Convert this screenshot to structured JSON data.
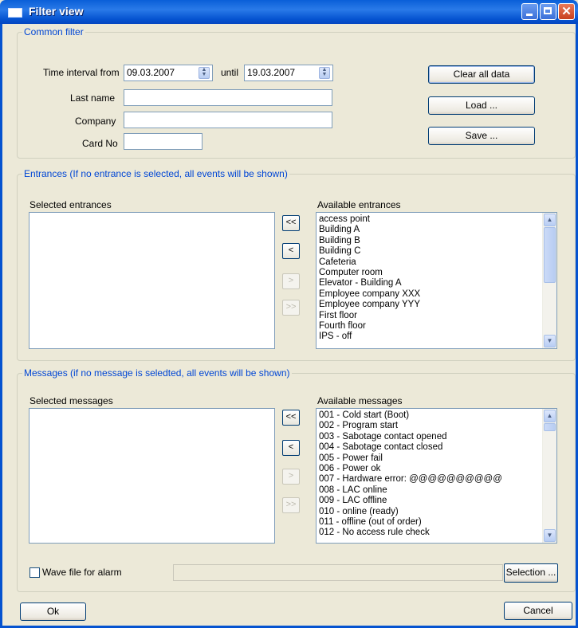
{
  "window": {
    "title": "Filter view"
  },
  "common_filter": {
    "legend": "Common filter",
    "time_from_label": "Time interval from",
    "time_from_value": "09.03.2007",
    "until_label": "until",
    "until_value": "19.03.2007",
    "last_name_label": "Last name",
    "last_name_value": "",
    "company_label": "Company",
    "company_value": "",
    "card_no_label": "Card No",
    "card_no_value": "",
    "clear_label": "Clear all data",
    "load_label": "Load ...",
    "save_label": "Save ..."
  },
  "entrances": {
    "legend": "Entrances (If  no entrance is selected, all events will be shown)",
    "selected_label": "Selected entrances",
    "available_label": "Available entrances",
    "available_items": [
      "access point",
      "Building A",
      "Building B",
      "Building C",
      "Cafeteria",
      "Computer room",
      "Elevator - Building A",
      "Employee company XXX",
      "Employee company YYY",
      "First floor",
      "Fourth floor",
      "IPS - off"
    ]
  },
  "messages": {
    "legend": "Messages (if no message is seledted, all events will be shown)",
    "selected_label": "Selected messages",
    "available_label": "Available messages",
    "available_items": [
      "001 - Cold start (Boot)",
      "002 - Program start",
      "003 - Sabotage contact opened",
      "004 - Sabotage contact closed",
      "005 - Power fail",
      "006 - Power ok",
      "007 - Hardware error: @@@@@@@@@@",
      "008 - LAC online",
      "009 - LAC offline",
      "010 - online (ready)",
      "011 - offline (out of order)",
      "012 - No access rule check"
    ],
    "wave_label": "Wave file for alarm",
    "wave_checked": false,
    "wave_value": "",
    "selection_label": "Selection ..."
  },
  "transfer": {
    "add_all": "<<",
    "add": "<",
    "remove": ">",
    "remove_all": ">>"
  },
  "footer": {
    "ok_label": "Ok",
    "cancel_label": "Cancel"
  },
  "icons": {
    "spin": "spinner-arrows-icon",
    "scroll_up": "chevron-up-icon",
    "scroll_down": "chevron-down-icon"
  },
  "colors": {
    "title_bar": "#0553d0",
    "legend": "#0046d5",
    "dialog_bg": "#ece9d8"
  }
}
